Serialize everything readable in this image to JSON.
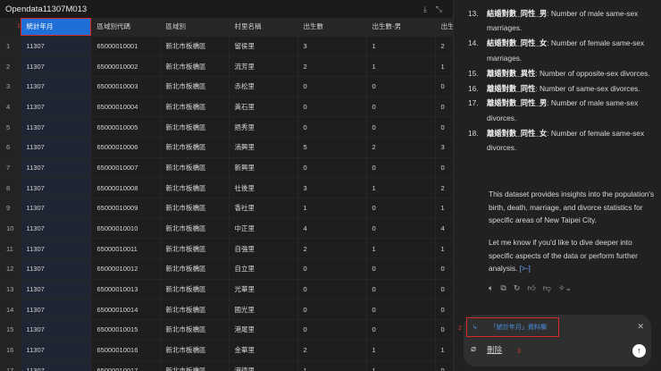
{
  "table": {
    "title": "Opendata11307M013",
    "columns": [
      "統計年月",
      "區域別代碼",
      "區域別",
      "村里名稱",
      "出生數",
      "出生數-男",
      "出生"
    ],
    "rows": [
      [
        "1",
        "11307",
        "65000010001",
        "新北市板橋區",
        "留侯里",
        "3",
        "1",
        "2"
      ],
      [
        "2",
        "11307",
        "65000010002",
        "新北市板橋區",
        "流芳里",
        "2",
        "1",
        "1"
      ],
      [
        "3",
        "11307",
        "65000010003",
        "新北市板橋區",
        "赤松里",
        "0",
        "0",
        "0"
      ],
      [
        "4",
        "11307",
        "65000010004",
        "新北市板橋區",
        "黃石里",
        "0",
        "0",
        "0"
      ],
      [
        "5",
        "11307",
        "65000010005",
        "新北市板橋區",
        "挹秀里",
        "0",
        "0",
        "0"
      ],
      [
        "6",
        "11307",
        "65000010006",
        "新北市板橋區",
        "湳興里",
        "5",
        "2",
        "3"
      ],
      [
        "7",
        "11307",
        "65000010007",
        "新北市板橋區",
        "新興里",
        "0",
        "0",
        "0"
      ],
      [
        "8",
        "11307",
        "65000010008",
        "新北市板橋區",
        "社後里",
        "3",
        "1",
        "2"
      ],
      [
        "9",
        "11307",
        "65000010009",
        "新北市板橋區",
        "香社里",
        "1",
        "0",
        "1"
      ],
      [
        "10",
        "11307",
        "65000010010",
        "新北市板橋區",
        "中正里",
        "4",
        "0",
        "4"
      ],
      [
        "11",
        "11307",
        "65000010011",
        "新北市板橋區",
        "自強里",
        "2",
        "1",
        "1"
      ],
      [
        "12",
        "11307",
        "65000010012",
        "新北市板橋區",
        "自立里",
        "0",
        "0",
        "0"
      ],
      [
        "13",
        "11307",
        "65000010013",
        "新北市板橋區",
        "光華里",
        "0",
        "0",
        "0"
      ],
      [
        "14",
        "11307",
        "65000010014",
        "新北市板橋區",
        "國光里",
        "0",
        "0",
        "0"
      ],
      [
        "15",
        "11307",
        "65000010015",
        "新北市板橋區",
        "港尾里",
        "0",
        "0",
        "0"
      ],
      [
        "16",
        "11307",
        "65000010016",
        "新北市板橋區",
        "金華里",
        "2",
        "1",
        "1"
      ],
      [
        "17",
        "11307",
        "65000010017",
        "新北市板橋區",
        "港德里",
        "1",
        "1",
        "0"
      ]
    ]
  },
  "chat": {
    "items": [
      {
        "n": "13.",
        "term": "結婚對數_同性_男",
        "desc": ": Number of male same-sex marriages."
      },
      {
        "n": "14.",
        "term": "結婚對數_同性_女",
        "desc": ": Number of female same-sex marriages."
      },
      {
        "n": "15.",
        "term": "離婚對數_異性",
        "desc": ": Number of opposite-sex divorces."
      },
      {
        "n": "16.",
        "term": "離婚對數_同性",
        "desc": ": Number of same-sex divorces."
      },
      {
        "n": "17.",
        "term": "離婚對數_同性_男",
        "desc": ": Number of male same-sex divorces."
      },
      {
        "n": "18.",
        "term": "離婚對數_同性_女",
        "desc": ": Number of female same-sex divorces."
      }
    ],
    "para1": "This dataset provides insights into the population's birth, death, marriage, and divorce statistics for specific areas of New Taipei City.",
    "para2": "Let me know if you'd like to dive deeper into specific aspects of the data or perform further analysis.",
    "cite": "[>-]",
    "quote": "「統計年月」資料欄",
    "input_value": "刪除"
  },
  "annotations": {
    "a1": "1",
    "a2": "2",
    "a3": "3"
  },
  "colors": {
    "accent": "#1f6fd6",
    "annotation": "#d42a2a"
  }
}
